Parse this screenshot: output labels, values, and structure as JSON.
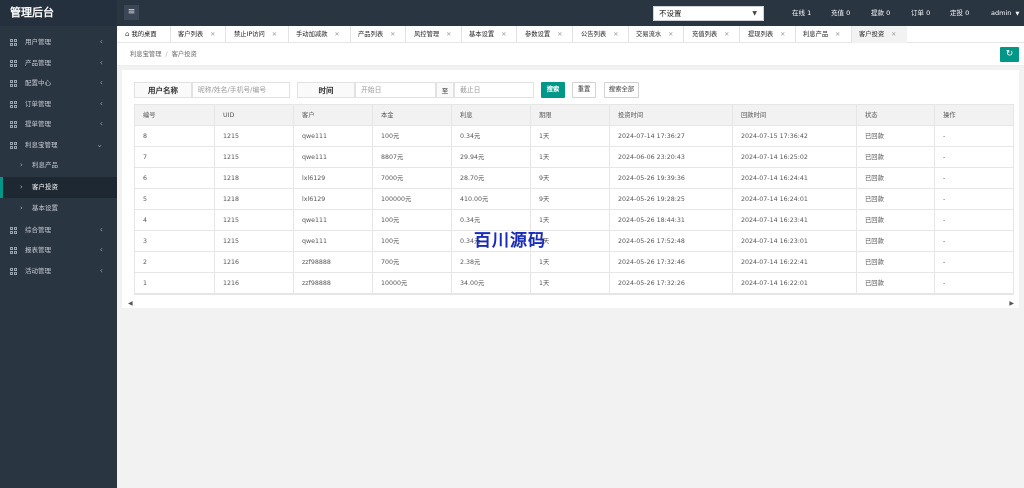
{
  "app_title": "管理后台",
  "sidebar": {
    "items": [
      {
        "label": "用户管理",
        "icon": "grid-icon"
      },
      {
        "label": "产品管理",
        "icon": "grid-icon"
      },
      {
        "label": "配置中心",
        "icon": "grid-icon"
      },
      {
        "label": "订单管理",
        "icon": "grid-icon"
      },
      {
        "label": "提单管理",
        "icon": "grid-icon"
      },
      {
        "label": "利息宝管理",
        "icon": "grid-icon",
        "expanded": true
      }
    ],
    "sub_items": [
      {
        "label": "利息产品",
        "active": false
      },
      {
        "label": "客户投资",
        "active": true
      },
      {
        "label": "基本设置",
        "active": false
      }
    ],
    "items_after": [
      {
        "label": "综合管理",
        "icon": "grid-icon"
      },
      {
        "label": "报表管理",
        "icon": "grid-icon"
      },
      {
        "label": "活动管理",
        "icon": "grid-icon"
      }
    ]
  },
  "topbar": {
    "menu_icon": "hamburger-icon",
    "select_value": "不设置",
    "stats": {
      "online": "在线 1",
      "recharge": "充值 0",
      "withdraw": "提款 0",
      "order": "订单 0",
      "fixed": "定投 0",
      "user": "admin"
    }
  },
  "tabs": [
    {
      "label": "我的桌面",
      "closable": false,
      "home": true
    },
    {
      "label": "客户列表",
      "closable": true
    },
    {
      "label": "禁止IP访问",
      "closable": true
    },
    {
      "label": "手动加减款",
      "closable": true
    },
    {
      "label": "产品列表",
      "closable": true
    },
    {
      "label": "风控管理",
      "closable": true
    },
    {
      "label": "基本设置",
      "closable": true
    },
    {
      "label": "参数设置",
      "closable": true
    },
    {
      "label": "公告列表",
      "closable": true
    },
    {
      "label": "交易流水",
      "closable": true
    },
    {
      "label": "充值列表",
      "closable": true
    },
    {
      "label": "提现列表",
      "closable": true
    },
    {
      "label": "利息产品",
      "closable": true
    },
    {
      "label": "客户投资",
      "closable": true,
      "active": true
    }
  ],
  "breadcrumb": {
    "parent": "利息宝管理",
    "separator": "/",
    "current": "客户投资"
  },
  "filters": {
    "user_label": "用户名称",
    "user_placeholder": "昵称/姓名/手机号/编号",
    "time_label": "时间",
    "start_placeholder": "开始日",
    "to_label": "至",
    "end_placeholder": "截止日",
    "search_btn": "搜索",
    "reset_btn": "重置",
    "search_all_btn": "搜索全部"
  },
  "table": {
    "headers": [
      "编号",
      "UID",
      "客户",
      "本金",
      "利息",
      "期限",
      "投资时间",
      "回款时间",
      "状态",
      "操作"
    ],
    "rows": [
      [
        "8",
        "1215",
        "qwe111",
        "100元",
        "0.34元",
        "1天",
        "2024-07-14 17:36:27",
        "2024-07-15 17:36:42",
        "已回款",
        "-"
      ],
      [
        "7",
        "1215",
        "qwe111",
        "8807元",
        "29.94元",
        "1天",
        "2024-06-06 23:20:43",
        "2024-07-14 16:25:02",
        "已回款",
        "-"
      ],
      [
        "6",
        "1218",
        "lxl6129",
        "7000元",
        "28.70元",
        "9天",
        "2024-05-26 19:39:36",
        "2024-07-14 16:24:41",
        "已回款",
        "-"
      ],
      [
        "5",
        "1218",
        "lxl6129",
        "100000元",
        "410.00元",
        "9天",
        "2024-05-26 19:28:25",
        "2024-07-14 16:24:01",
        "已回款",
        "-"
      ],
      [
        "4",
        "1215",
        "qwe111",
        "100元",
        "0.34元",
        "1天",
        "2024-05-26 18:44:31",
        "2024-07-14 16:23:41",
        "已回款",
        "-"
      ],
      [
        "3",
        "1215",
        "qwe111",
        "100元",
        "0.34元",
        "1天",
        "2024-05-26 17:52:48",
        "2024-07-14 16:23:01",
        "已回款",
        "-"
      ],
      [
        "2",
        "1216",
        "zzf98888",
        "700元",
        "2.38元",
        "1天",
        "2024-05-26 17:32:46",
        "2024-07-14 16:22:41",
        "已回款",
        "-"
      ],
      [
        "1",
        "1216",
        "zzf98888",
        "10000元",
        "34.00元",
        "1天",
        "2024-05-26 17:32:26",
        "2024-07-14 16:22:01",
        "已回款",
        "-"
      ]
    ]
  },
  "watermark": "百川源码",
  "colors": {
    "sidebar_bg": "#2a3542",
    "accent": "#009688",
    "watermark": "#1a2bb8"
  }
}
